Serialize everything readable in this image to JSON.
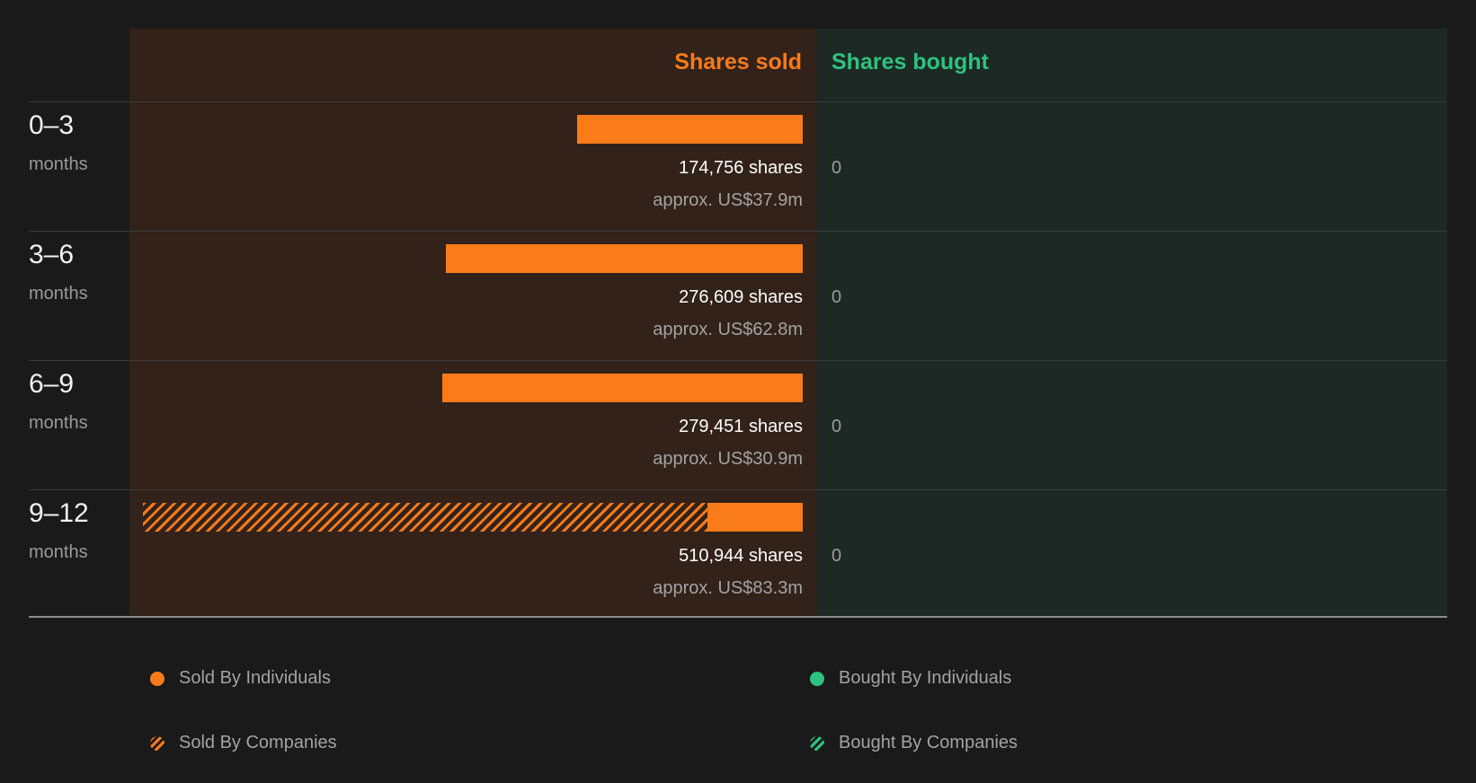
{
  "chart_data": {
    "type": "bar",
    "orientation": "horizontal",
    "columns": {
      "sold_label": "Shares sold",
      "bought_label": "Shares bought"
    },
    "periods": [
      {
        "range": "0-3",
        "unit": "months",
        "sold_individuals": 174756,
        "sold_companies": 0,
        "sold_shares_text": "174,756 shares",
        "sold_value_text": "approx. US$37.9m",
        "bought_text": "0"
      },
      {
        "range": "3-6",
        "unit": "months",
        "sold_individuals": 276609,
        "sold_companies": 0,
        "sold_shares_text": "276,609 shares",
        "sold_value_text": "approx. US$62.8m",
        "bought_text": "0"
      },
      {
        "range": "6-9",
        "unit": "months",
        "sold_individuals": 279451,
        "sold_companies": 0,
        "sold_shares_text": "279,451 shares",
        "sold_value_text": "approx. US$30.9m",
        "bought_text": "0"
      },
      {
        "range": "9-12",
        "unit": "months",
        "sold_individuals": 74000,
        "sold_companies": 436944,
        "sold_shares_text": "510,944 shares",
        "sold_value_text": "approx. US$83.3m",
        "bought_text": "0"
      }
    ],
    "legend": [
      {
        "label": "Sold By Individuals",
        "style": "solid",
        "color": "#f97b19"
      },
      {
        "label": "Bought By Individuals",
        "style": "solid",
        "color": "#2ec27e"
      },
      {
        "label": "Sold By Companies",
        "style": "hatched",
        "color": "#f97b19"
      },
      {
        "label": "Bought By Companies",
        "style": "hatched",
        "color": "#2ec27e"
      }
    ]
  }
}
